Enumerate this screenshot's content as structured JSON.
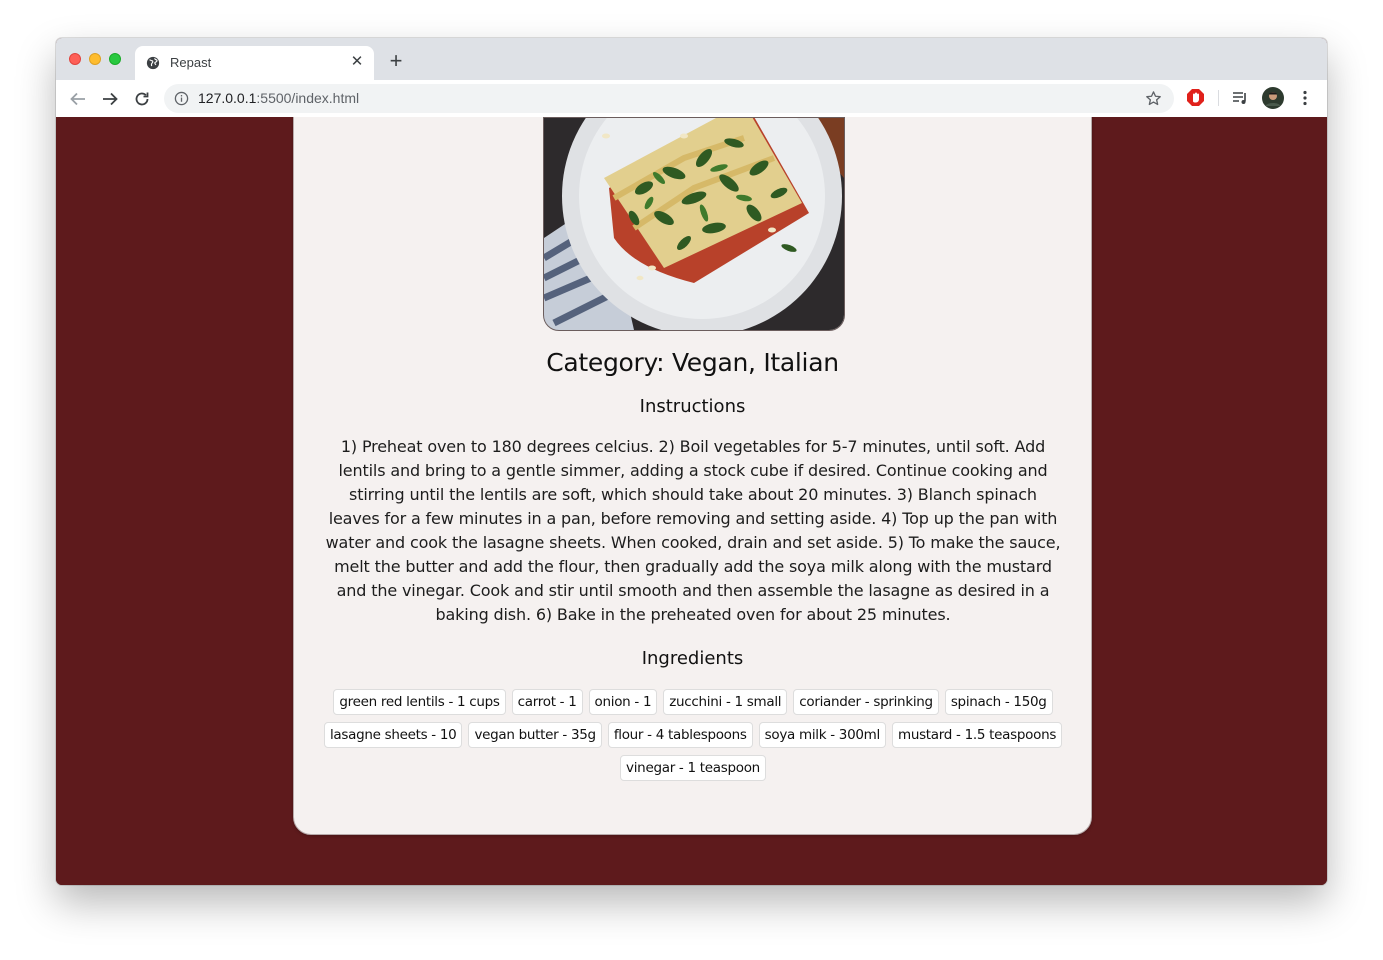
{
  "browser": {
    "tab": {
      "title": "Repast"
    },
    "url": {
      "host": "127.0.0.1",
      "rest": ":5500/index.html"
    }
  },
  "recipe": {
    "category": "Category: Vegan, Italian",
    "instructions_heading": "Instructions",
    "instructions": "1) Preheat oven to 180 degrees celcius. 2) Boil vegetables for 5-7 minutes, until soft. Add lentils and bring to a gentle simmer, adding a stock cube if desired. Continue cooking and stirring until the lentils are soft, which should take about 20 minutes. 3) Blanch spinach leaves for a few minutes in a pan, before removing and setting aside. 4) Top up the pan with water and cook the lasagne sheets. When cooked, drain and set aside. 5) To make the sauce, melt the butter and add the flour, then gradually add the soya milk along with the mustard and the vinegar. Cook and stir until smooth and then assemble the lasagne as desired in a baking dish. 6) Bake in the preheated oven for about 25 minutes.",
    "ingredients_heading": "Ingredients",
    "ingredients": [
      "green red lentils - 1 cups",
      "carrot - 1",
      "onion - 1",
      "zucchini - 1 small",
      "coriander - sprinking",
      "spinach - 150g",
      "lasagne sheets - 10",
      "vegan butter - 35g",
      "flour - 4 tablespoons",
      "soya milk - 300ml",
      "mustard - 1.5 teaspoons",
      "vinegar - 1 teaspoon"
    ]
  },
  "colors": {
    "page_background": "#5e1a1c",
    "card_background": "#f5f1f0"
  }
}
